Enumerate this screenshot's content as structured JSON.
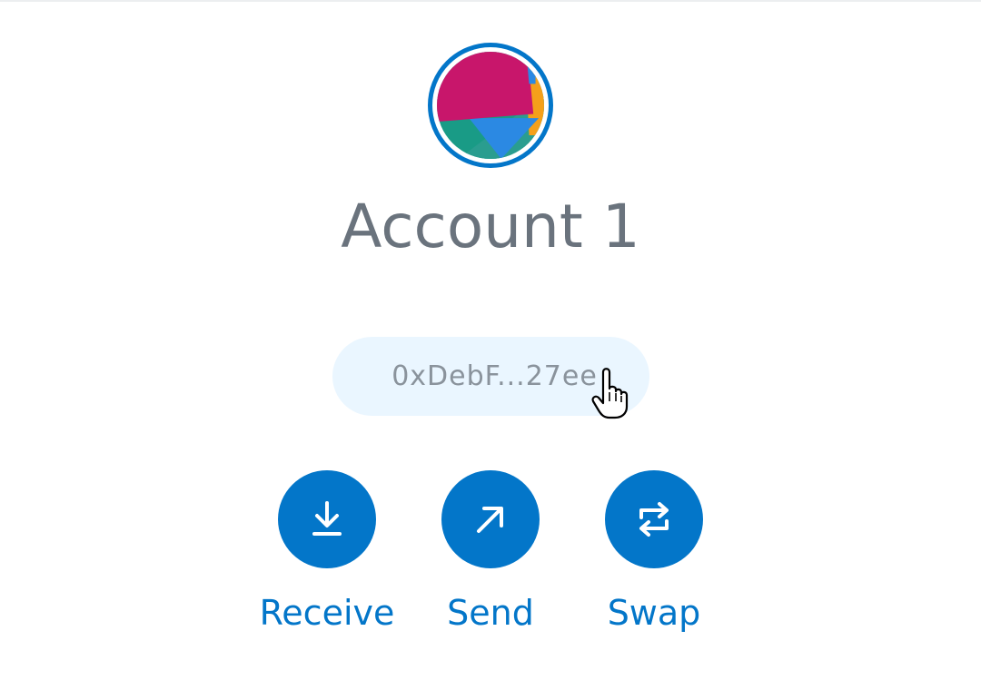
{
  "account": {
    "name": "Account 1",
    "address_short": "0xDebF...27ee"
  },
  "actions": [
    {
      "label": "Receive",
      "icon": "download-icon"
    },
    {
      "label": "Send",
      "icon": "arrow-up-right-icon"
    },
    {
      "label": "Swap",
      "icon": "swap-arrows-icon"
    }
  ],
  "colors": {
    "accent": "#0376c9",
    "address_pill_bg": "#eaf6ff",
    "account_name": "#6a737d",
    "address_text": "#8a939c"
  }
}
